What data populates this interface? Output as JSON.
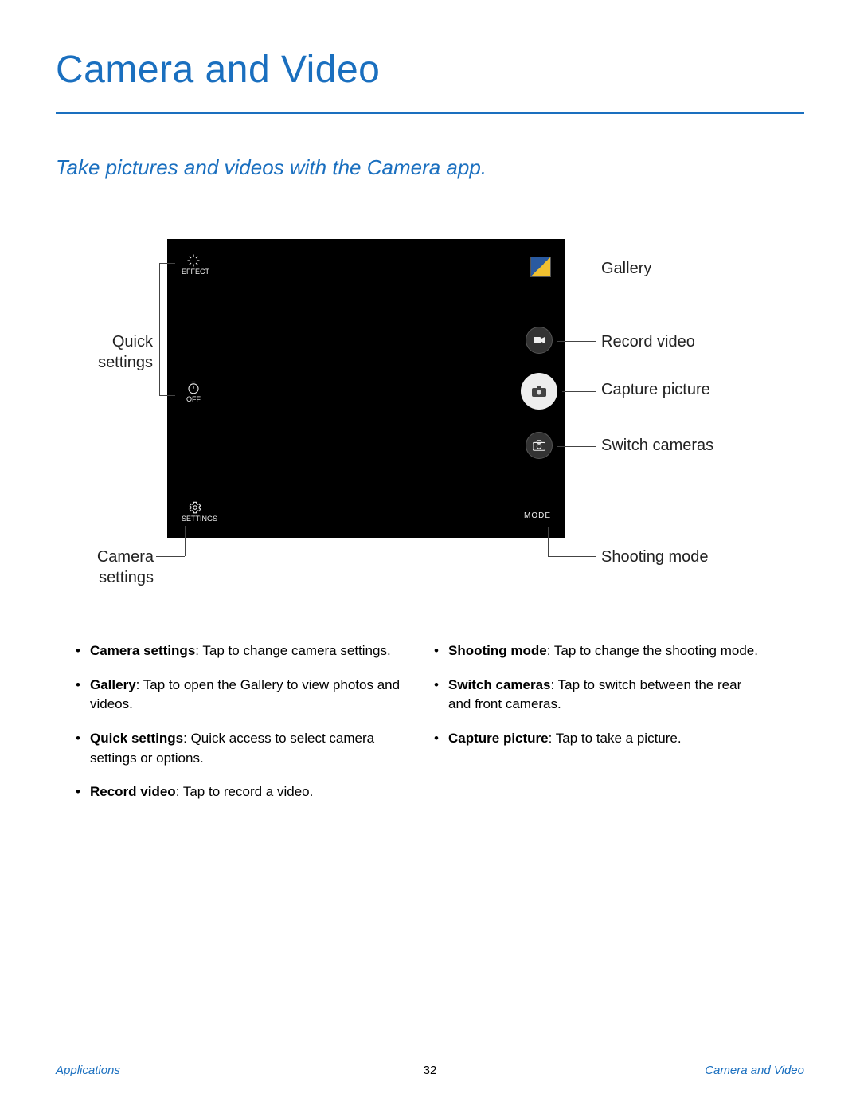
{
  "title": "Camera and Video",
  "subtitle": "Take pictures and videos with the Camera app.",
  "cam": {
    "effect_label": "EFFECT",
    "timer_label": "OFF",
    "settings_label": "SETTINGS",
    "mode_label": "MODE"
  },
  "anno": {
    "quick_settings": "Quick settings",
    "camera_settings": "Camera settings",
    "gallery": "Gallery",
    "record_video": "Record video",
    "capture_picture": "Capture picture",
    "switch_cameras": "Switch cameras",
    "shooting_mode": "Shooting mode"
  },
  "bullets_left": [
    {
      "term": "Camera settings",
      "desc": ": Tap to change camera settings."
    },
    {
      "term": "Gallery",
      "desc": ": Tap to open the Gallery to view photos and videos."
    },
    {
      "term": "Quick settings",
      "desc": ": Quick access to select camera settings or options."
    },
    {
      "term": "Record video",
      "desc": ": Tap to record a video."
    }
  ],
  "bullets_right": [
    {
      "term": "Shooting mode",
      "desc": ": Tap to change the shooting mode."
    },
    {
      "term": "Switch cameras",
      "desc": ": Tap to switch between the rear and front cameras."
    },
    {
      "term": "Capture picture",
      "desc": ": Tap to take a picture."
    }
  ],
  "footer": {
    "left": "Applications",
    "center": "32",
    "right": "Camera and Video"
  }
}
